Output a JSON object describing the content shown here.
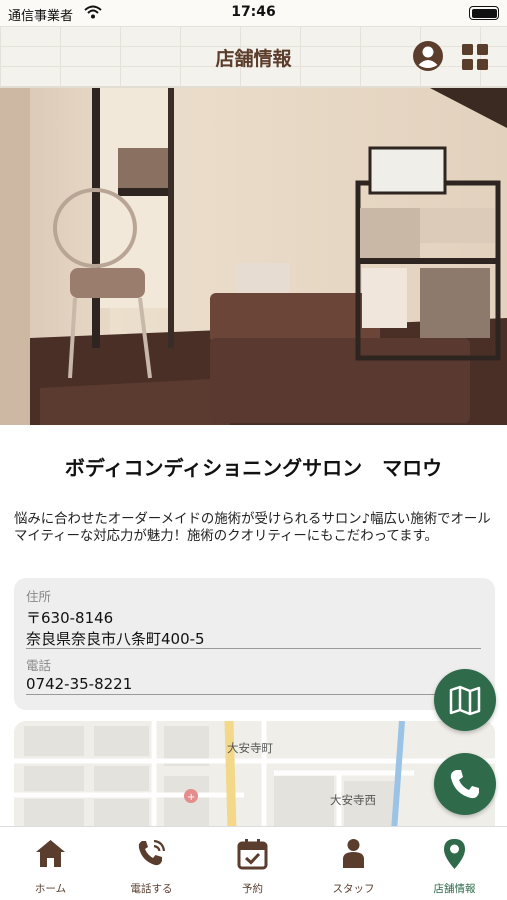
{
  "status_bar": {
    "carrier": "通信事業者",
    "time": "17:46",
    "icons": [
      "wifi-icon",
      "battery-icon"
    ]
  },
  "header": {
    "title": "店舗情報",
    "icons": [
      "account-icon",
      "grid-menu-icon"
    ]
  },
  "salon": {
    "name": "ボディコンディショニングサロン　マロウ",
    "description": "悩みに合わせたオーダーメイドの施術が受けられるサロン♪幅広い施術でオールマイティーな対応力が魅力！施術のクオリティーにもこだわってます。"
  },
  "info": {
    "address_label": "住所",
    "postal_code": "〒630-8146",
    "address": "奈良県奈良市八条町400-5",
    "phone_label": "電話",
    "phone": "0742-35-8221"
  },
  "map": {
    "labels": [
      "大安寺町",
      "大安寺西"
    ]
  },
  "floating_buttons": [
    "map-icon",
    "phone-icon"
  ],
  "tabs": [
    {
      "label": "ホーム",
      "icon": "home-icon"
    },
    {
      "label": "電話する",
      "icon": "phone-call-icon"
    },
    {
      "label": "予約",
      "icon": "calendar-icon"
    },
    {
      "label": "スタッフ",
      "icon": "person-icon"
    },
    {
      "label": "店舗情報",
      "icon": "location-pin-icon",
      "active": true
    }
  ],
  "colors": {
    "brand_brown": "#5b3d2c",
    "accent_green": "#2f6b4a",
    "header_bg": "#f4f2ed",
    "card_bg": "#eeeeee"
  }
}
